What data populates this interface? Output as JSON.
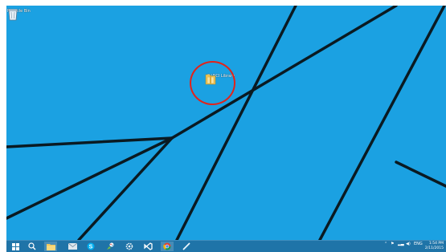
{
  "desktop": {
    "wallpaper_color": "#1ba1e2",
    "icons": [
      {
        "label": "Recycle Bin",
        "icon": "recycle-bin-icon"
      },
      {
        "label": "C:\\DCI Library",
        "icon": "folder-icon"
      }
    ],
    "highlight_color": "#e2231a"
  },
  "taskbar": {
    "color": "#1f74a8",
    "pinned": [
      {
        "icon": "windows-start-icon"
      },
      {
        "icon": "search-icon"
      },
      {
        "icon": "file-explorer-icon"
      },
      {
        "icon": "mail-icon"
      },
      {
        "icon": "skype-icon"
      },
      {
        "icon": "paint-icon"
      },
      {
        "icon": "settings-icon"
      },
      {
        "icon": "visual-studio-icon"
      },
      {
        "icon": "chrome-icon"
      },
      {
        "icon": "pen-tool-icon"
      }
    ],
    "tray": {
      "language": "ENG",
      "time": "1:54 PM",
      "date": "2/11/2015"
    }
  }
}
